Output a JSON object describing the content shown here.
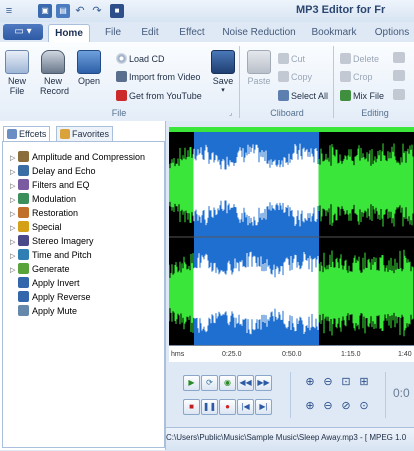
{
  "window": {
    "title": "MP3 Editor for Fr"
  },
  "quick_access": [
    "menu-glyph",
    "save-icon",
    "open-icon",
    "undo-icon",
    "redo-icon",
    "floppy-icon"
  ],
  "menu_button": {
    "icon": "app-menu-icon",
    "glyph": "▾"
  },
  "tabs": [
    "Home",
    "File",
    "Edit",
    "Effect",
    "Noise Reduction",
    "Bookmark",
    "Options"
  ],
  "ribbon": {
    "file_group": {
      "label": "File",
      "new_file": "New\nFile",
      "new_record": "New\nRecord",
      "open": "Open",
      "load_cd": "Load CD",
      "import_video": "Import from Video",
      "get_youtube": "Get from YouTube",
      "save": "Save"
    },
    "clipboard_group": {
      "label": "Cliboard",
      "paste": "Paste",
      "cut": "Cut",
      "copy": "Copy",
      "select_all": "Select All"
    },
    "editing_group": {
      "label": "Editing",
      "delete": "Delete",
      "crop": "Crop",
      "mix_file": "Mix File"
    }
  },
  "panel": {
    "tabs": [
      "Effcets",
      "Favorites"
    ],
    "tree": [
      {
        "label": "Amplitude and Compression",
        "expandable": true,
        "color": "#8a6d3b"
      },
      {
        "label": "Delay and Echo",
        "expandable": true,
        "color": "#3b6ea5"
      },
      {
        "label": "Filters and EQ",
        "expandable": true,
        "color": "#7a5aa0"
      },
      {
        "label": "Modulation",
        "expandable": true,
        "color": "#3a8f5a"
      },
      {
        "label": "Restoration",
        "expandable": true,
        "color": "#c0702a"
      },
      {
        "label": "Special",
        "expandable": true,
        "color": "#d4a017"
      },
      {
        "label": "Stereo Imagery",
        "expandable": true,
        "color": "#4a4a8a"
      },
      {
        "label": "Time and Pitch",
        "expandable": true,
        "color": "#2f7fb5"
      },
      {
        "label": "Generate",
        "expandable": true,
        "color": "#5aa33a"
      },
      {
        "label": "Apply Invert",
        "expandable": false,
        "color": "#3366aa"
      },
      {
        "label": "Apply Reverse",
        "expandable": false,
        "color": "#3366aa"
      },
      {
        "label": "Apply Mute",
        "expandable": false,
        "color": "#6688aa"
      }
    ]
  },
  "timeline": {
    "labels": [
      "hms",
      "0:25.0",
      "0:50.0",
      "1:15.0",
      "1:40"
    ]
  },
  "colors": {
    "waveform": "#39e639",
    "selection": "#1e6fd0",
    "selection_wave": "#ffffff",
    "background": "#000000",
    "accent": "#2d5aa4"
  },
  "transport": {
    "row1": [
      "play-icon",
      "loop-icon",
      "play-selection-icon",
      "rewind-icon",
      "fast-forward-icon"
    ],
    "row2": [
      "stop-icon",
      "pause-icon",
      "record-icon",
      "skip-start-icon",
      "skip-end-icon"
    ]
  },
  "zoom": {
    "row1": [
      "zoom-in-icon",
      "zoom-out-icon",
      "zoom-selection-icon",
      "zoom-full-icon"
    ],
    "row2": [
      "zoom-vert-in-icon",
      "zoom-vert-out-icon",
      "zoom-fit-icon",
      "zoom-reset-icon"
    ]
  },
  "time_display": "0:0",
  "status": {
    "path": "C:\\Users\\Public\\Music\\Sample Music\\Sleep Away.mp3 - [ MPEG 1.0"
  }
}
